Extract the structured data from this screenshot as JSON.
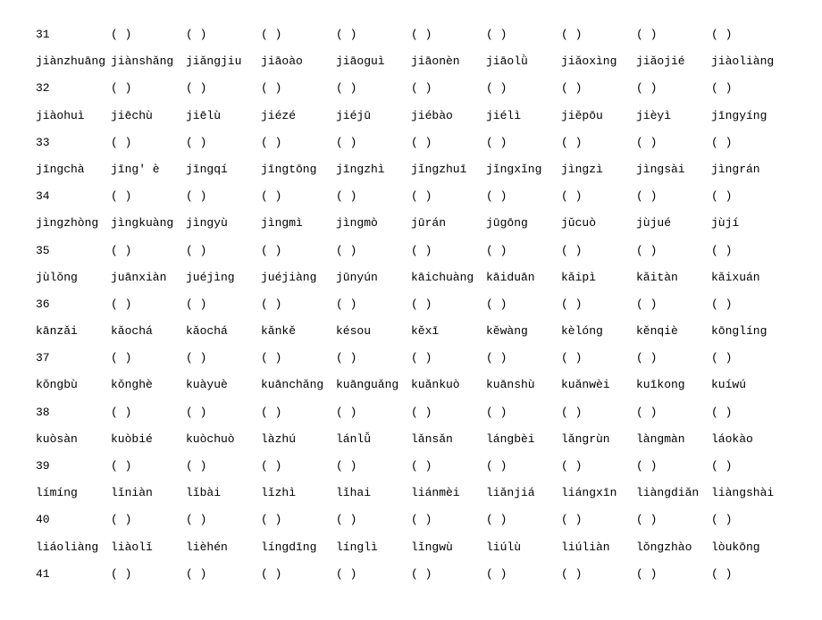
{
  "rows": [
    {
      "type": "blanks",
      "number": "31",
      "count": 10
    },
    {
      "type": "words",
      "words": [
        "jiànzhuāng",
        "jiànshǎng",
        "jiǎngjiu",
        "jiāoào",
        "jiāoguì",
        "jiāonèn",
        "jiāolǜ",
        "jiǎoxìng",
        "jiǎojié",
        "jiàoliàng"
      ]
    },
    {
      "type": "blanks",
      "number": "32",
      "count": 10
    },
    {
      "type": "words",
      "words": [
        "jiàohuì",
        "jiēchù",
        "jiēlù",
        "jiézé",
        "jiéjū",
        "jiébào",
        "jiélì",
        "jiěpōu",
        "jièyì",
        "jīngyíng"
      ]
    },
    {
      "type": "blanks",
      "number": "33",
      "count": 10
    },
    {
      "type": "words",
      "words": [
        "jīngchà",
        "jīng' è",
        "jīngqí",
        "jīngtōng",
        "jīngzhì",
        "jǐngzhuī",
        "jǐngxǐng",
        "jìngzì",
        "jìngsài",
        "jìngrán"
      ]
    },
    {
      "type": "blanks",
      "number": "34",
      "count": 10
    },
    {
      "type": "words",
      "words": [
        "jìngzhòng",
        "jìngkuàng",
        "jìngyù",
        "jìngmì",
        "jìngmò",
        "jūrán",
        "jūgōng",
        "jǔcuò",
        "jùjué",
        "jùjí"
      ]
    },
    {
      "type": "blanks",
      "number": "35",
      "count": 10
    },
    {
      "type": "words",
      "words": [
        "jùlǒng",
        "juānxiàn",
        "juéjìng",
        "juéjiàng",
        "jūnyún",
        "kāichuàng",
        "kāiduān",
        "kǎipì",
        "kǎitàn",
        "kǎixuán"
      ]
    },
    {
      "type": "blanks",
      "number": "36",
      "count": 10
    },
    {
      "type": "words",
      "words": [
        "kānzǎi",
        "kǎochá",
        "kǎochá",
        "kǎnkě",
        "késou",
        "kěxī",
        "kěwàng",
        "kèlóng",
        "kěnqiè",
        "kōnglíng"
      ]
    },
    {
      "type": "blanks",
      "number": "37",
      "count": 10
    },
    {
      "type": "words",
      "words": [
        "kǒngbù",
        "kǒnghè",
        "kuàyuè",
        "kuānchǎng",
        "kuānguǎng",
        "kuǎnkuò",
        "kuānshù",
        "kuǎnwèi",
        "kuīkong",
        "kuíwú"
      ]
    },
    {
      "type": "blanks",
      "number": "38",
      "count": 10
    },
    {
      "type": "words",
      "words": [
        "kuòsàn",
        "kuòbié",
        "kuòchuò",
        "làzhú",
        "lánlǚ",
        "lǎnsǎn",
        "lángbèi",
        "lǎngrùn",
        "làngmàn",
        "láokào"
      ]
    },
    {
      "type": "blanks",
      "number": "39",
      "count": 10
    },
    {
      "type": "words",
      "words": [
        "límíng",
        "lǐniàn",
        "lǐbài",
        "lǐzhì",
        "lǐhai",
        "liánmèi",
        "liǎnjiá",
        "liángxīn",
        "liàngdiǎn",
        "liàngshài"
      ]
    },
    {
      "type": "blanks",
      "number": "40",
      "count": 10
    },
    {
      "type": "words",
      "words": [
        "liáoliàng",
        "liàolǐ",
        "lièhén",
        "língdīng",
        "línglì",
        "lǐngwù",
        "liúlù",
        "liúliàn",
        "lǒngzhào",
        "lòukōng"
      ]
    },
    {
      "type": "blanks",
      "number": "41",
      "count": 10
    }
  ]
}
